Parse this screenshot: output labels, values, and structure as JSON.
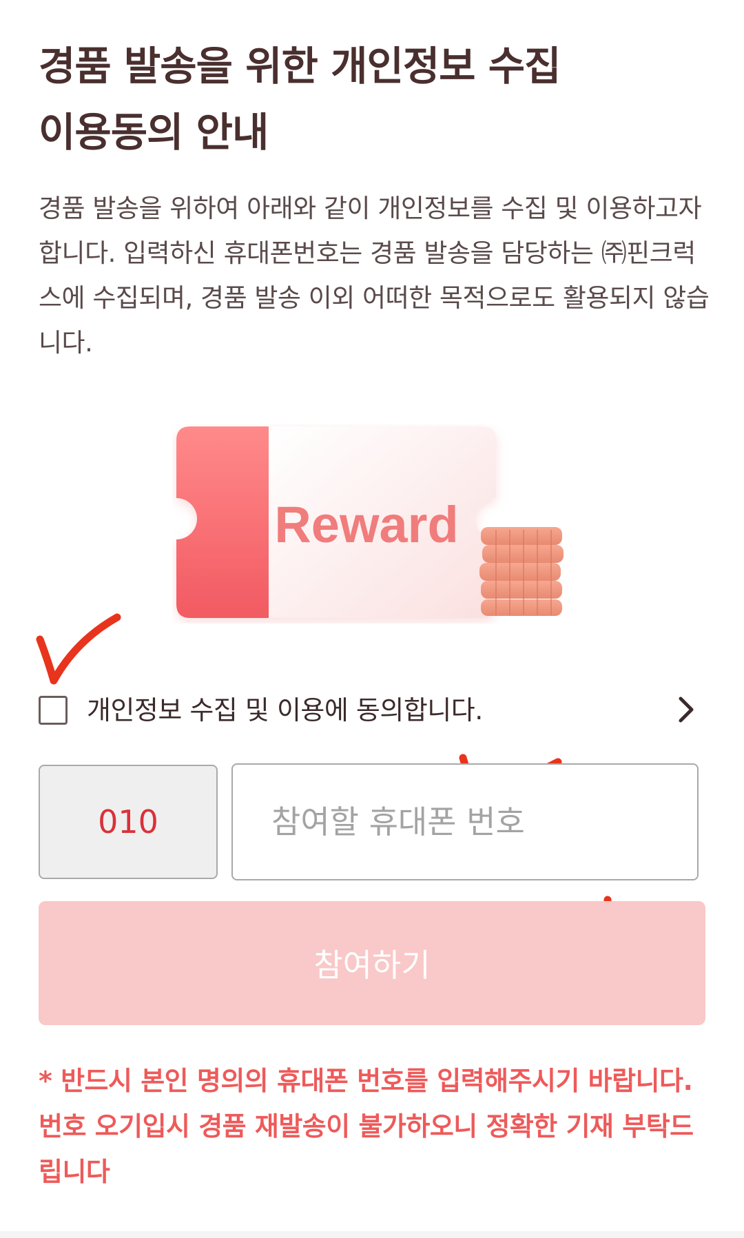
{
  "header": {
    "title": "경품 발송을 위한 개인정보 수집\n이용동의 안내"
  },
  "description": "경품 발송을 위하여 아래와 같이 개인정보를 수집 및 이용하고자 합니다. 입력하신 휴대폰번호는 경품 발송을 담당하는 ㈜핀크럭스에 수집되며, 경품 발송 이외 어떠한 목적으로도 활용되지 않습니다.",
  "illustration": {
    "ticket_text": "Reward",
    "icon_name": "reward-ticket-with-coins"
  },
  "agreement": {
    "label": "개인정보 수집 및 이용에 동의합니다.",
    "checked": false,
    "chevron_icon": "chevron-right-icon"
  },
  "phone": {
    "prefix": "010",
    "placeholder": "참여할 휴대폰 번호",
    "value": ""
  },
  "submit": {
    "label": "참여하기"
  },
  "notice": "* 반드시 본인 명의의 휴대폰 번호를 입력해주시기 바랍니다. 번호 오기입시 경품 재발송이 불가하오니 정확한 기재 부탁드립니다",
  "colors": {
    "title": "#4a2f2f",
    "accent_red": "#d9313a",
    "notice_red": "#ee5a5a",
    "button_bg": "#f9c8c8",
    "annotation_mark": "#e8341c"
  }
}
